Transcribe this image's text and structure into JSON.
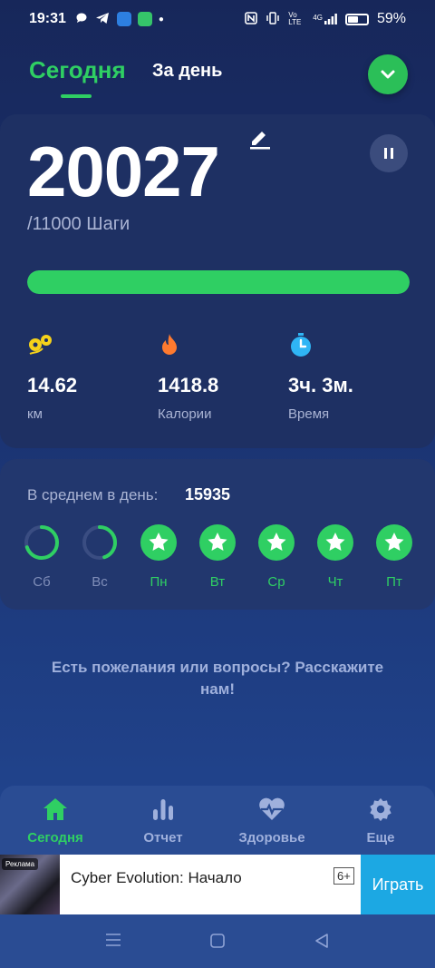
{
  "status_bar": {
    "time": "19:31",
    "battery_pct": "59%",
    "battery_level": 0.59,
    "net_label": "Vo LTE",
    "signal_label": "4G"
  },
  "header": {
    "tab_today": "Сегодня",
    "tab_day": "За день"
  },
  "steps": {
    "count": "20027",
    "goal_text": "/11000 Шаги",
    "progress": 1.0
  },
  "stats": [
    {
      "value": "14.62",
      "label": "км",
      "icon": "distance-icon",
      "color": "#f5d21a"
    },
    {
      "value": "1418.8",
      "label": "Калории",
      "icon": "flame-icon",
      "color": "#ff7a2f"
    },
    {
      "value": "3ч. 3м.",
      "label": "Время",
      "icon": "stopwatch-icon",
      "color": "#2fb5f5"
    }
  ],
  "average": {
    "label": "В среднем в день:",
    "value": "15935",
    "days": [
      {
        "label": "Сб",
        "state": "partial",
        "progress": 0.7
      },
      {
        "label": "Вс",
        "state": "partial",
        "progress": 0.45
      },
      {
        "label": "Пн",
        "state": "done"
      },
      {
        "label": "Вт",
        "state": "done"
      },
      {
        "label": "Ср",
        "state": "done"
      },
      {
        "label": "Чт",
        "state": "done"
      },
      {
        "label": "Пт",
        "state": "done"
      }
    ]
  },
  "feedback": "Есть пожелания или вопросы? Расскажите нам!",
  "nav": [
    {
      "label": "Сегодня",
      "icon": "home-icon",
      "active": true
    },
    {
      "label": "Отчет",
      "icon": "bar-chart-icon",
      "active": false
    },
    {
      "label": "Здоровье",
      "icon": "heart-pulse-icon",
      "active": false
    },
    {
      "label": "Еще",
      "icon": "gear-icon",
      "active": false
    }
  ],
  "ad": {
    "tag": "Реклама",
    "title": "Cyber Evolution: Начало",
    "age": "6+",
    "button": "Играть"
  },
  "colors": {
    "accent": "#2fcf63",
    "muted": "#aab4d4",
    "card": "#1e3063"
  }
}
